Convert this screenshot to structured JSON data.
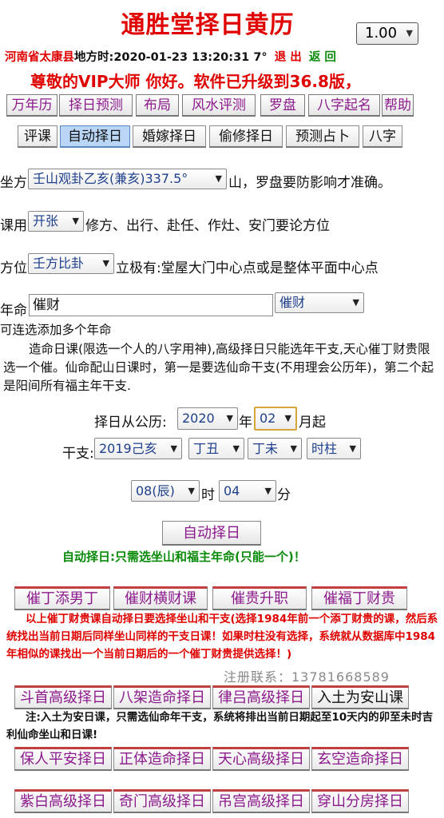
{
  "app_title": "通胜堂择日黄历",
  "zoom": {
    "value": "1.00"
  },
  "info": {
    "location": "河南省太康县",
    "time_label": "地方时:",
    "time_value": "2020-01-23 13:20:31",
    "temperature": "7°",
    "logout": "退 出",
    "back": "返 回"
  },
  "welcome": "尊敬的VIP大师 你好。软件已升级到36.8版，",
  "top_buttons": [
    "万年历",
    "择日预测",
    "布局",
    "风水评测",
    "罗盘",
    "八字起名",
    "帮助"
  ],
  "tabs": [
    "评课",
    "自动择日",
    "婚嫁择日",
    "偷修择日",
    "预测占卜",
    "八字"
  ],
  "sitting": {
    "label": "坐方",
    "value": "壬山观卦乙亥(兼亥)337.5°",
    "suffix": "山，罗盘要防影响才准确。"
  },
  "usage": {
    "label": "课用",
    "value": "开张",
    "suffix": "修方、出行、赴任、作灶、安门要论方位"
  },
  "direction": {
    "label": "方位",
    "value": "壬方比卦",
    "suffix": "立极有:堂屋大门中心点或是整体平面中心点"
  },
  "year_life": {
    "label": "年命",
    "input_value": "催财",
    "select_value": "催财"
  },
  "multi_note": "可连选添加多个年命",
  "description": "造命日课(限选一个人的八字用神),高级择日只能选年干支,天心催丁财贵限选一个催。仙命配山日课时，第一是要选仙命干支(不用理会公历年)，第二个起是阳间所有福主年干支.",
  "date_from": {
    "label": "择日从公历:",
    "year": "2020",
    "year_unit": "年",
    "month": "02",
    "month_suffix": "月起"
  },
  "ganzhi": {
    "label": "干支:",
    "year": "2019己亥",
    "month": "丁丑",
    "day": "丁未",
    "hour": "时柱"
  },
  "time_pick": {
    "hour": "08(辰)",
    "hour_unit": "时",
    "minute": "04",
    "minute_unit": "分"
  },
  "auto_button": "自动择日",
  "auto_note": "自动择日:只需选坐山和福主年命(只能一个)！",
  "red_buttons": [
    "催丁添男丁",
    "催财横财课",
    "催贵升职",
    "催福丁财贵"
  ],
  "red_note": "以上催丁财贵课自动择日要选择坐山和干支(选择1984年前一个添丁财贵的课，然后系统找出当前日期后同样坐山同样的干支日课！如果时柱没有选择，系统就从数据库中1984年相似的课找出一个当前日期后的一个催丁财贵提供选择！)",
  "watermark": "注册联系：13781668589",
  "row_a": [
    "斗首高级择日",
    "八架造命择日",
    "律吕高级择日",
    "入土为安山课"
  ],
  "note2": "注:入土为安日课，只需选仙命年干支，系统将排出当前日期起至10天内的卯至未时吉利仙命坐山和日课!",
  "row_b": [
    "保人平安择日",
    "正体造命择日",
    "天心高级择日",
    "玄空造命择日"
  ],
  "row_c": [
    "紫白高级择日",
    "奇门高级择日",
    "吊宫高级择日",
    "穿山分房择日"
  ]
}
